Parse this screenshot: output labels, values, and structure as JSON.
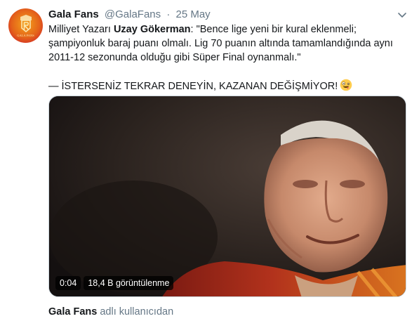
{
  "tweet": {
    "author_name": "Gala Fans",
    "author_handle": "@GalaFans",
    "separator": "·",
    "date": "25 May",
    "avatar_icon": "galatasaray-crest-icon",
    "avatar_text": "GALA FANS",
    "text_prefix": "Milliyet Yazarı ",
    "text_bold": "Uzay Gökerman",
    "text_rest": ": \"Bence lige yeni bir kural eklenmeli; şampiyonluk baraj puanı olmalı. Lig 70 puanın altında tamamlandığında aynı 2011-12 sezonunda olduğu gibi Süper Final oynanmalı.\"",
    "text_line2": "— İSTERSENİZ TEKRAR DENEYİN, KAZANAN DEĞİŞMİYOR!",
    "emoji": "zany-face-emoji"
  },
  "video": {
    "duration": "0:04",
    "views": "18,4 B görüntülenme"
  },
  "footer": {
    "by_name": "Gala Fans",
    "by_suffix": " adlı kullanıcıdan"
  },
  "colors": {
    "secondary_text": "#657786",
    "primary_text": "#14171a",
    "brand_red": "#c8102e",
    "brand_yellow": "#f4a21b"
  }
}
